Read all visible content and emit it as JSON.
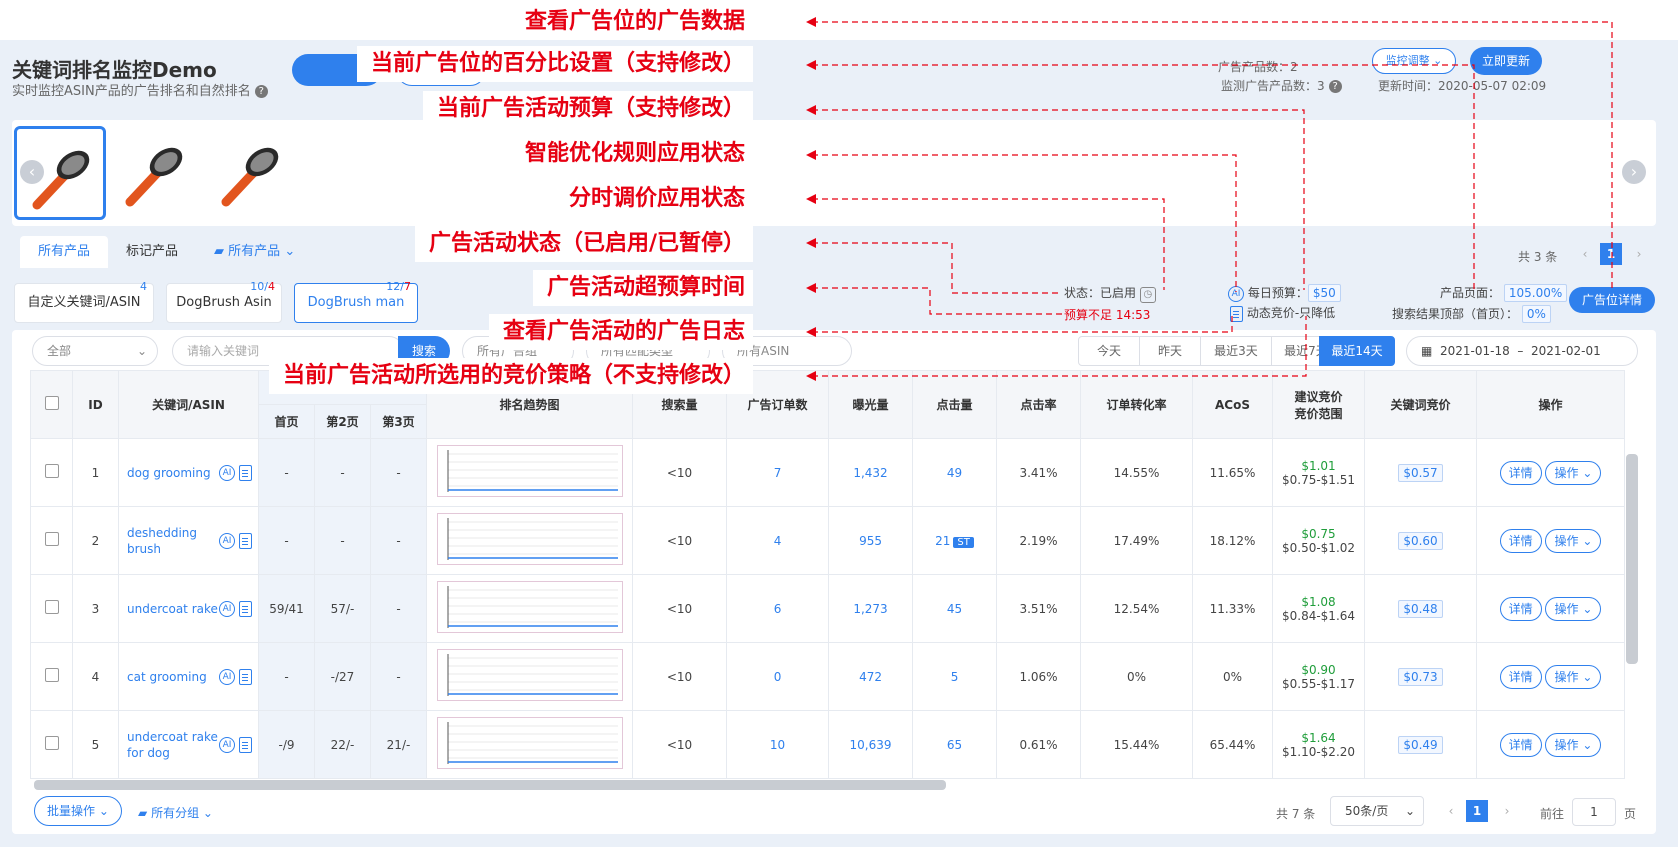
{
  "header": {
    "title": "关键词排名监控Demo",
    "subtitle": "实时监控ASIN产品的广告排名和自然排名",
    "stat_ad_products": "广告产品数：",
    "stat_ad_products_value": "2",
    "stat_monitored": "监测广告产品数：",
    "stat_monitored_value": "3",
    "updated_label": "更新时间：",
    "updated_value": "2020-05-07 02:09",
    "monitor_adjust": "监控调整",
    "update_now": "立即更新"
  },
  "tabs": [
    "所有产品",
    "标记产品"
  ],
  "product_filter": "所有产品",
  "product_pager": {
    "total": "共 3 条",
    "page": "1"
  },
  "groups": [
    {
      "label": "自定义关键词/ASIN",
      "badge": "4"
    },
    {
      "label": "DogBrush Asin",
      "badge_a": "10",
      "badge_b": "4"
    },
    {
      "label": "DogBrush man",
      "badge_a": "12",
      "badge_b": "7"
    }
  ],
  "campaign": {
    "status_label": "状态：",
    "status_value": "已启用",
    "over_budget": "预算不足 14:53",
    "daily_budget_label": "每日预算：",
    "daily_budget_value": "$50",
    "bid_strategy": "动态竞价-只降低",
    "product_page_label": "产品页面：",
    "product_page_value": "105.00%",
    "top_search_label": "搜索结果顶部（首页）：",
    "top_search_value": "0%",
    "placement_button": "广告位详情"
  },
  "filters": {
    "all": "全部",
    "keyword_placeholder": "请输入关键词",
    "search": "搜索",
    "group": "所有广告组",
    "match": "所有匹配类型",
    "asin": "所有ASIN"
  },
  "date_buttons": [
    "今天",
    "昨天",
    "最近3天",
    "最近7天",
    "最近14天"
  ],
  "date_range": {
    "start": "2021-01-18",
    "sep": "–",
    "end": "2021-02-01"
  },
  "table": {
    "headers": {
      "id": "ID",
      "keyword": "关键词/ASIN",
      "p1": "首页",
      "p2": "第2页",
      "p3": "第3页",
      "trend": "排名趋势图",
      "search": "搜索量",
      "orders": "广告订单数",
      "impr": "曝光量",
      "clicks": "点击量",
      "ctr": "点击率",
      "cvr": "订单转化率",
      "acos": "ACoS",
      "suggest_a": "建议竞价",
      "suggest_b": "竞价范围",
      "bid": "关键词竞价",
      "ops": "操作"
    },
    "rows": [
      {
        "id": "1",
        "kw": "dog grooming",
        "p1": "-",
        "p2": "-",
        "p3": "-",
        "search": "<10",
        "orders": "7",
        "impr": "1,432",
        "clicks": "49",
        "st": "",
        "ctr": "3.41%",
        "cvr": "14.55%",
        "acos": "11.65%",
        "sug": "$1.01",
        "range": "$0.75-$1.51",
        "bid": "$0.57"
      },
      {
        "id": "2",
        "kw": "deshedding brush",
        "p1": "-",
        "p2": "-",
        "p3": "-",
        "search": "<10",
        "orders": "4",
        "impr": "955",
        "clicks": "21",
        "st": "ST",
        "ctr": "2.19%",
        "cvr": "17.49%",
        "acos": "18.12%",
        "sug": "$0.75",
        "range": "$0.50-$1.02",
        "bid": "$0.60"
      },
      {
        "id": "3",
        "kw": "undercoat rake",
        "p1": "59/41",
        "p2": "57/-",
        "p3": "-",
        "search": "<10",
        "orders": "6",
        "impr": "1,273",
        "clicks": "45",
        "st": "",
        "ctr": "3.51%",
        "cvr": "12.54%",
        "acos": "11.33%",
        "sug": "$1.08",
        "range": "$0.84-$1.64",
        "bid": "$0.48"
      },
      {
        "id": "4",
        "kw": "cat grooming",
        "p1": "-",
        "p2": "-/27",
        "p3": "-",
        "search": "<10",
        "orders": "0",
        "impr": "472",
        "clicks": "5",
        "st": "",
        "ctr": "1.06%",
        "cvr": "0%",
        "acos": "0%",
        "sug": "$0.90",
        "range": "$0.55-$1.17",
        "bid": "$0.73"
      },
      {
        "id": "5",
        "kw": "undercoat rake for dog",
        "p1": "-/9",
        "p2": "22/-",
        "p3": "21/-",
        "search": "<10",
        "orders": "10",
        "impr": "10,639",
        "clicks": "65",
        "st": "",
        "ctr": "0.61%",
        "cvr": "15.44%",
        "acos": "65.44%",
        "sug": "$1.64",
        "range": "$1.10-$2.20",
        "bid": "$0.49"
      }
    ],
    "detail": "详情",
    "action": "操作"
  },
  "footer": {
    "batch": "批量操作",
    "all_groups": "所有分组",
    "total": "共 7 条",
    "per_page": "50条/页",
    "page": "1",
    "goto": "前往",
    "goto_value": "1",
    "page_unit": "页"
  },
  "annotations": [
    "查看广告位的广告数据",
    "当前广告位的百分比设置（支持修改）",
    "当前广告活动预算（支持修改）",
    "智能优化规则应用状态",
    "分时调价应用状态",
    "广告活动状态（已启用/已暂停）",
    "广告活动超预算时间",
    "查看广告活动的广告日志",
    "当前广告活动所选用的竞价策略（不支持修改）"
  ],
  "colors": {
    "accent": "#2f80ed",
    "annotation": "#e60012",
    "green": "#1f9d3a"
  }
}
